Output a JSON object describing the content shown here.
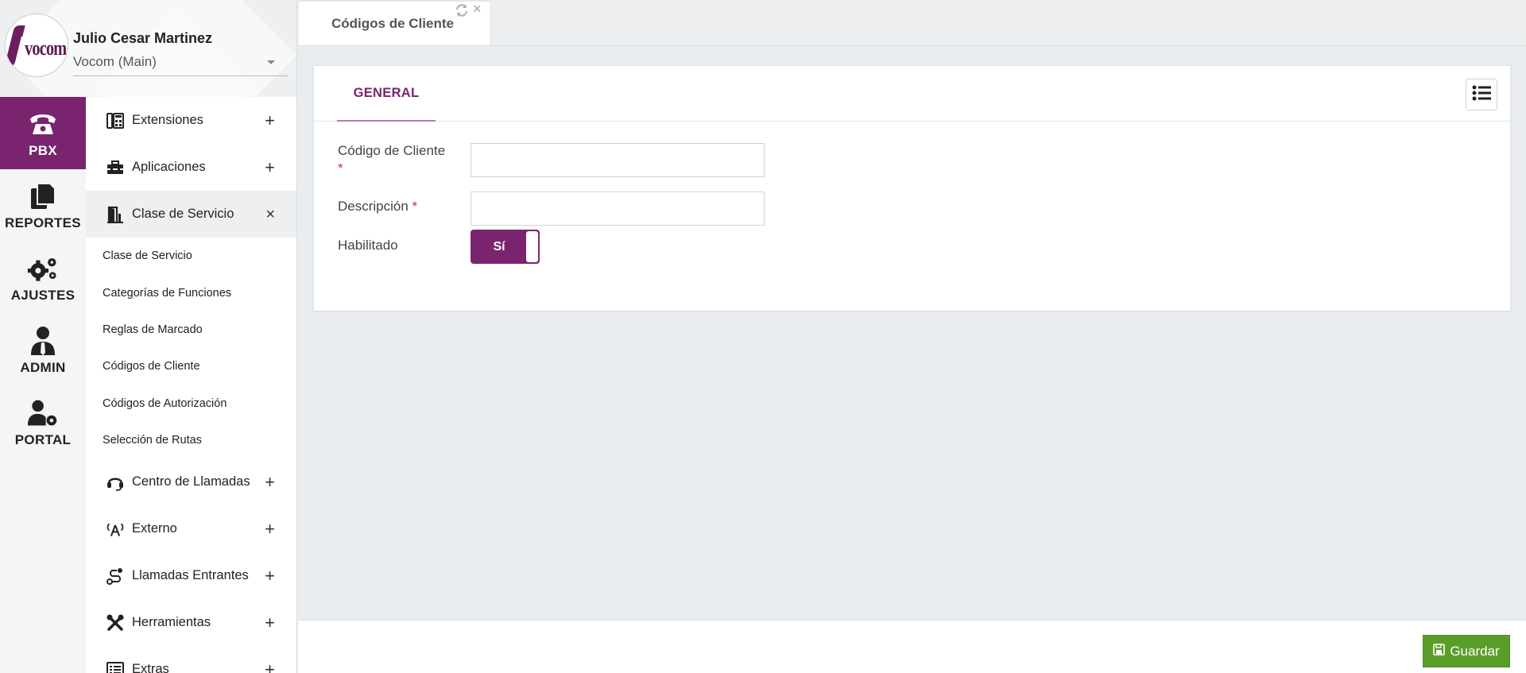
{
  "header": {
    "logo_text": "vocom",
    "user_name": "Julio Cesar Martinez",
    "tenant": "Vocom (Main)"
  },
  "rail": [
    {
      "label": "PBX",
      "icon": "phone-icon",
      "active": true
    },
    {
      "label": "REPORTES",
      "icon": "documents-icon",
      "active": false
    },
    {
      "label": "AJUSTES",
      "icon": "gears-icon",
      "active": false
    },
    {
      "label": "ADMIN",
      "icon": "user-tie-icon",
      "active": false
    },
    {
      "label": "PORTAL",
      "icon": "user-gear-icon",
      "active": false
    }
  ],
  "menu": {
    "extensiones": {
      "label": "Extensiones",
      "toggle": "+",
      "icon": "fax-icon"
    },
    "aplicaciones": {
      "label": "Aplicaciones",
      "toggle": "+",
      "icon": "toolbox-icon"
    },
    "clase_servicio": {
      "label": "Clase de Servicio",
      "toggle": "×",
      "icon": "door-icon"
    },
    "sub_items": [
      "Clase de Servicio",
      "Categorías de Funciones",
      "Reglas de Marcado",
      "Códigos de Cliente",
      "Códigos de Autorización",
      "Selección de Rutas"
    ],
    "centro_llamadas": {
      "label": "Centro de Llamadas",
      "toggle": "+",
      "icon": "headset-icon"
    },
    "externo": {
      "label": "Externo",
      "toggle": "+",
      "icon": "antenna-icon"
    },
    "llamadas_entrantes": {
      "label": "Llamadas Entrantes",
      "toggle": "+",
      "icon": "route-icon"
    },
    "herramientas": {
      "label": "Herramientas",
      "toggle": "+",
      "icon": "tools-icon"
    },
    "extras": {
      "label": "Extras",
      "toggle": "+",
      "icon": "list-alt-icon"
    }
  },
  "tab": {
    "title": "Códigos de Cliente",
    "close": "×"
  },
  "card": {
    "tab_general": "GENERAL"
  },
  "form": {
    "codigo_label": "Código de Cliente",
    "codigo_value": "",
    "descripcion_label": "Descripción",
    "descripcion_value": "",
    "habilitado_label": "Habilitado",
    "habilitado_value": "Sí",
    "required_mark": "*"
  },
  "footer": {
    "save_label": "Guardar"
  },
  "colors": {
    "brand": "#7a2470",
    "save": "#5a9e2a",
    "required": "#d32f2f"
  }
}
